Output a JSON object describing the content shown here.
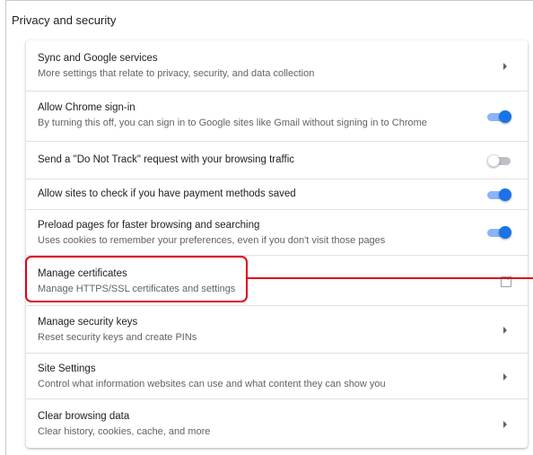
{
  "section": {
    "title": "Privacy and security"
  },
  "rows": [
    {
      "id": "sync",
      "title": "Sync and Google services",
      "subtitle": "More settings that relate to privacy, security, and data collection",
      "control": "arrow"
    },
    {
      "id": "signin",
      "title": "Allow Chrome sign-in",
      "subtitle": "By turning this off, you can sign in to Google sites like Gmail without signing in to Chrome",
      "control": "toggle",
      "enabled": true
    },
    {
      "id": "dnt",
      "title": "Send a \"Do Not Track\" request with your browsing traffic",
      "control": "toggle",
      "enabled": false
    },
    {
      "id": "payment",
      "title": "Allow sites to check if you have payment methods saved",
      "control": "toggle",
      "enabled": true
    },
    {
      "id": "preload",
      "title": "Preload pages for faster browsing and searching",
      "subtitle": "Uses cookies to remember your preferences, even if you don't visit those pages",
      "control": "toggle",
      "enabled": true
    },
    {
      "id": "certificates",
      "title": "Manage certificates",
      "subtitle": "Manage HTTPS/SSL certificates and settings",
      "control": "external-link"
    },
    {
      "id": "security-keys",
      "title": "Manage security keys",
      "subtitle": "Reset security keys and create PINs",
      "control": "arrow"
    },
    {
      "id": "site-settings",
      "title": "Site Settings",
      "subtitle": "Control what information websites can use and what content they can show you",
      "control": "arrow"
    },
    {
      "id": "clear-data",
      "title": "Clear browsing data",
      "subtitle": "Clear history, cookies, cache, and more",
      "control": "arrow"
    }
  ],
  "colors": {
    "toggle_on_knob": "#1a73e8",
    "toggle_on_track": "#8ab4f8",
    "highlight": "#e0001b"
  },
  "icons": {
    "arrow": "triangle-right-icon",
    "external": "open-in-new-icon"
  }
}
